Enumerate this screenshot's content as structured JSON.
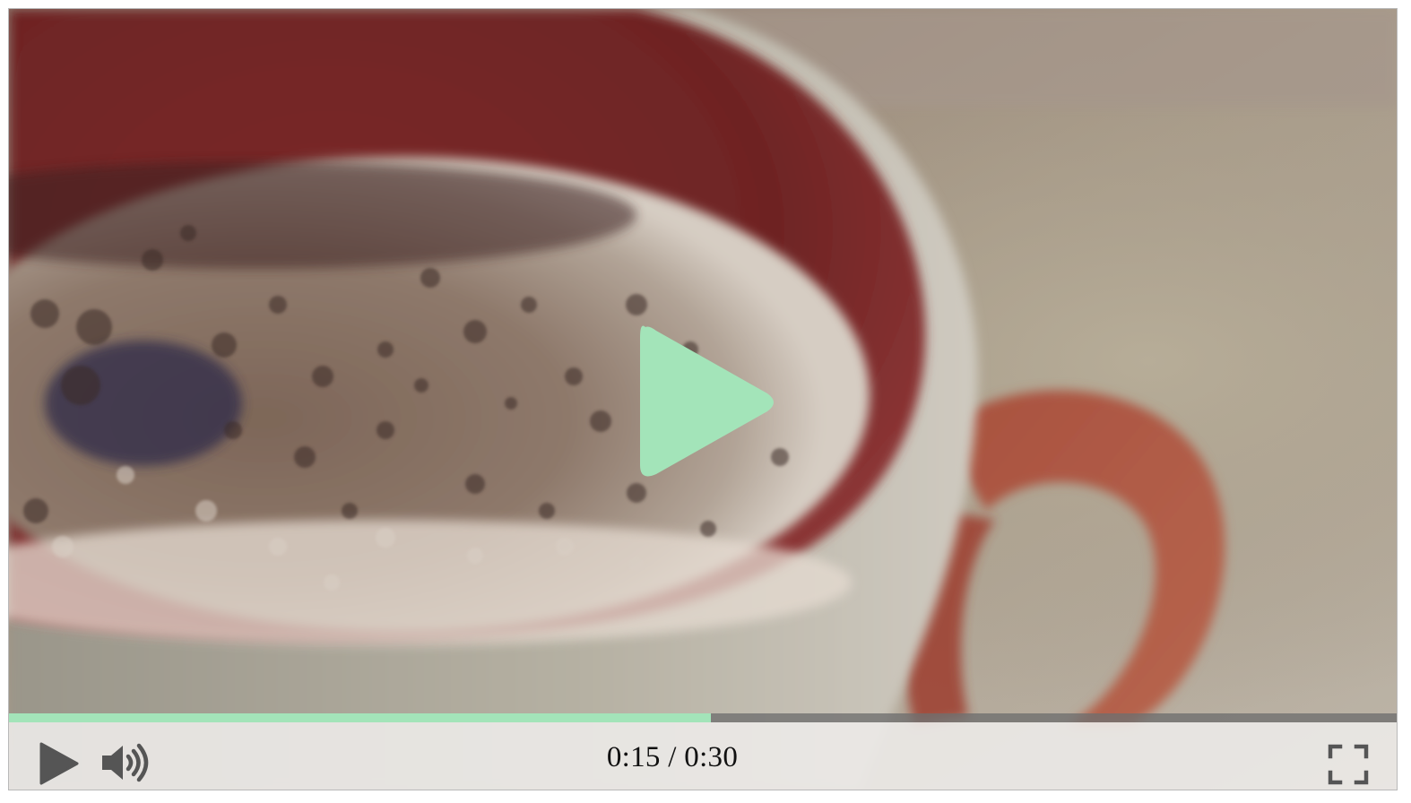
{
  "player": {
    "accent_color": "#a3e4b9",
    "progress_fraction": 0.505,
    "current_time": "0:15",
    "separator": " / ",
    "duration": "0:30",
    "paused": true
  },
  "icons": {
    "center_play": "play-icon",
    "play": "play-icon",
    "volume": "volume-icon",
    "fullscreen": "fullscreen-icon"
  }
}
